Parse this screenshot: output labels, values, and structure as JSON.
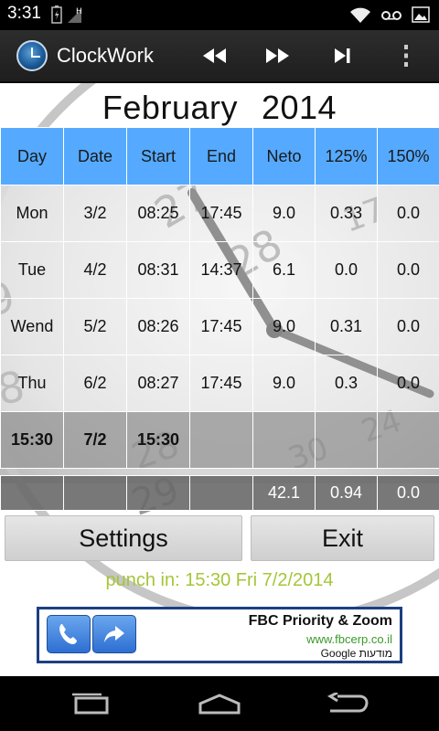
{
  "status_bar": {
    "time": "3:31",
    "icons": [
      "battery-charging-icon",
      "signal-h-icon",
      "wifi-icon",
      "voicemail-icon",
      "image-icon"
    ]
  },
  "action_bar": {
    "title": "ClockWork",
    "actions": [
      "rewind-icon",
      "fast-forward-icon",
      "skip-next-icon",
      "overflow-menu-icon"
    ]
  },
  "month": {
    "name": "February",
    "year": "2014"
  },
  "table": {
    "headers": [
      "Day",
      "Date",
      "Start",
      "End",
      "Neto",
      "125%",
      "150%"
    ],
    "rows": [
      [
        "Mon",
        "3/2",
        "08:25",
        "17:45",
        "9.0",
        "0.33",
        "0.0"
      ],
      [
        "Tue",
        "4/2",
        "08:31",
        "14:37",
        "6.1",
        "0.0",
        "0.0"
      ],
      [
        "Wend",
        "5/2",
        "08:26",
        "17:45",
        "9.0",
        "0.31",
        "0.0"
      ],
      [
        "Thu",
        "6/2",
        "08:27",
        "17:45",
        "9.0",
        "0.3",
        "0.0"
      ]
    ],
    "current_row": [
      "15:30",
      "7/2",
      "15:30",
      "",
      "",
      "",
      ""
    ],
    "totals": [
      "",
      "",
      "",
      "",
      "42.1",
      "0.94",
      "0.0"
    ]
  },
  "buttons": {
    "settings": "Settings",
    "exit": "Exit"
  },
  "punch_status": "punch in: 15:30 Fri 7/2/2014",
  "ad": {
    "title": "FBC Priority & Zoom",
    "url": "www.fbcerp.co.il",
    "note": "Google מודעות",
    "border_color": "#1c3f82"
  },
  "colors": {
    "header_bg": "#55aaff",
    "punch_text": "#a4c639",
    "action_bar": "#262626"
  },
  "nav_bar": {
    "buttons": [
      "back-icon",
      "home-icon",
      "recent-apps-icon"
    ]
  }
}
